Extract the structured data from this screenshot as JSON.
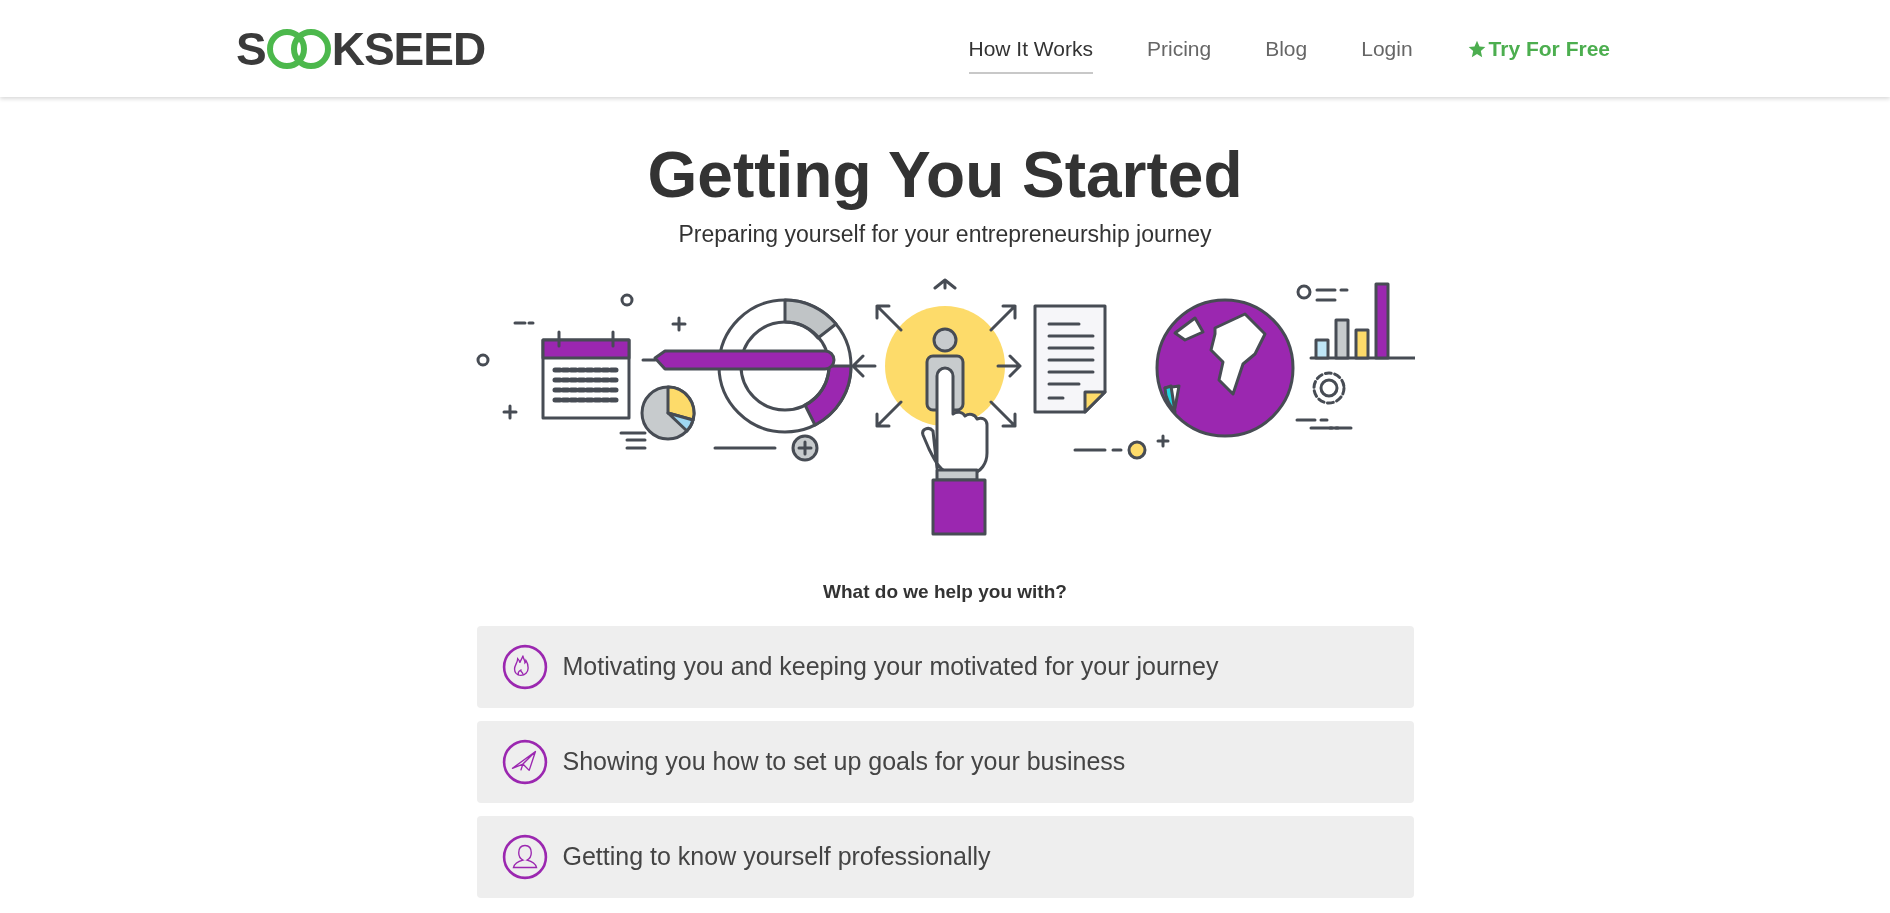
{
  "logo": {
    "lead": "S",
    "tail": "KSEED"
  },
  "nav": [
    {
      "label": "How It Works",
      "selected": true,
      "kind": "link"
    },
    {
      "label": "Pricing",
      "selected": false,
      "kind": "link"
    },
    {
      "label": "Blog",
      "selected": false,
      "kind": "link"
    },
    {
      "label": "Login",
      "selected": false,
      "kind": "link"
    },
    {
      "label": "Try For Free",
      "selected": false,
      "kind": "cta"
    }
  ],
  "hero": {
    "title": "Getting You Started",
    "subtitle": "Preparing yourself for your entrepreneurship journey"
  },
  "help": {
    "heading": "What do we help you with?",
    "items": [
      {
        "kind": "fire",
        "text": "Motivating you and keeping your motivated for your journey"
      },
      {
        "kind": "plane",
        "text": "Showing you how to set up goals for your business"
      },
      {
        "kind": "person",
        "text": "Getting to know yourself professionally"
      }
    ]
  }
}
